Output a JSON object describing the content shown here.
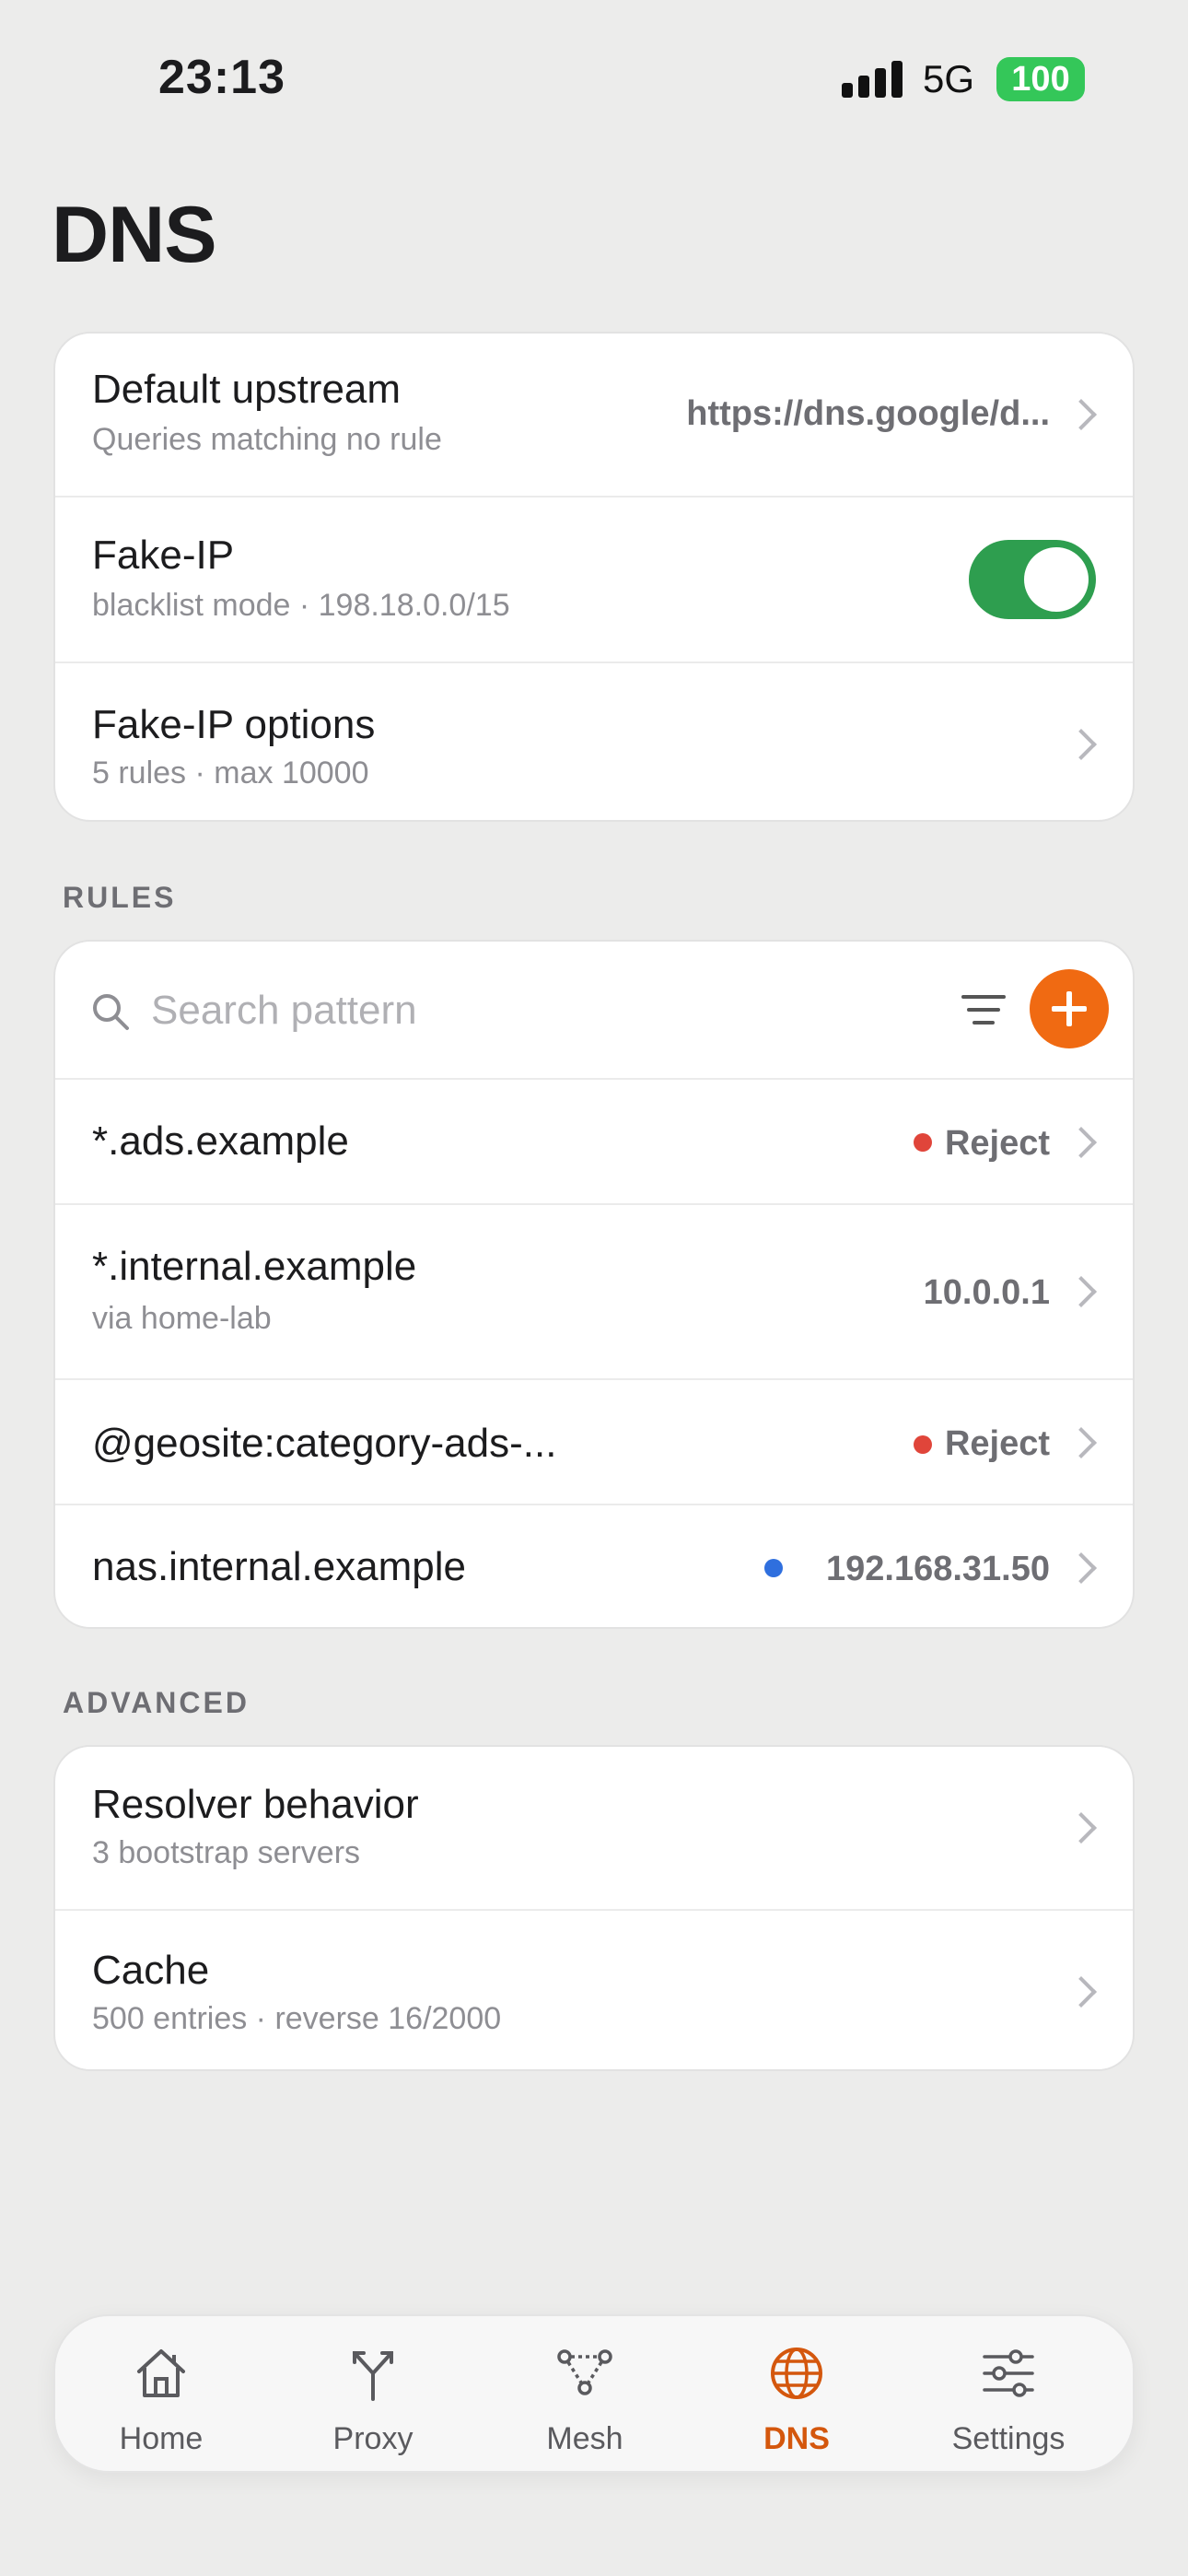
{
  "status_bar": {
    "time": "23:13",
    "network": "5G",
    "battery": "100"
  },
  "page": {
    "title": "DNS"
  },
  "general": {
    "default_upstream": {
      "title": "Default upstream",
      "subtitle": "Queries matching no rule",
      "value": "https://dns.google/d..."
    },
    "fake_ip": {
      "title": "Fake-IP",
      "subtitle": "blacklist mode · 198.18.0.0/15",
      "enabled": true
    },
    "fake_ip_options": {
      "title": "Fake-IP options",
      "subtitle": "5 rules · max 10000"
    }
  },
  "rules": {
    "section_label": "RULES",
    "search_placeholder": "Search pattern",
    "items": [
      {
        "pattern": "*.ads.example",
        "action": "Reject",
        "dot_color": "#e0453a"
      },
      {
        "pattern": "*.internal.example",
        "subtitle": "via home-lab",
        "action": "10.0.0.1"
      },
      {
        "pattern": "@geosite:category-ads-...",
        "action": "Reject",
        "dot_color": "#e0453a"
      },
      {
        "pattern": "nas.internal.example",
        "action": "192.168.31.50",
        "dot_color": "#2f6fde"
      }
    ]
  },
  "advanced": {
    "section_label": "ADVANCED",
    "resolver": {
      "title": "Resolver behavior",
      "subtitle": "3 bootstrap servers"
    },
    "cache": {
      "title": "Cache",
      "subtitle": "500 entries · reverse 16/2000"
    }
  },
  "tab_bar": {
    "active": "DNS",
    "accent_color": "#d4570d",
    "tabs": [
      {
        "label": "Home",
        "icon": "house-icon"
      },
      {
        "label": "Proxy",
        "icon": "fork-arrows-icon"
      },
      {
        "label": "Mesh",
        "icon": "mesh-nodes-icon"
      },
      {
        "label": "DNS",
        "icon": "globe-icon"
      },
      {
        "label": "Settings",
        "icon": "sliders-icon"
      }
    ]
  }
}
